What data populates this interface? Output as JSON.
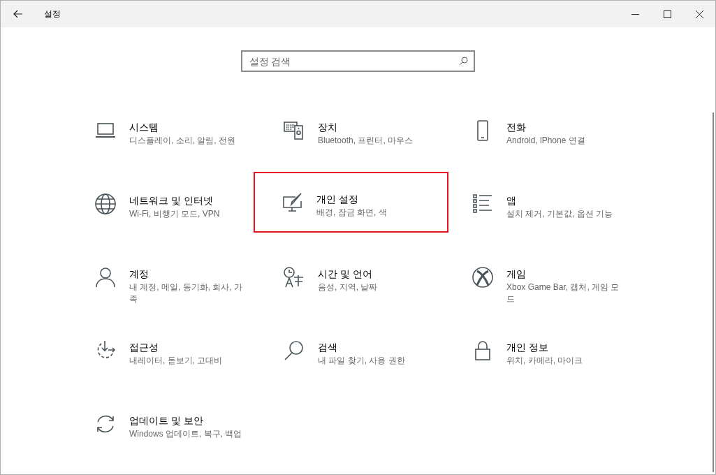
{
  "window": {
    "title": "설정"
  },
  "search": {
    "placeholder": "설정 검색"
  },
  "tiles": [
    {
      "title": "시스템",
      "subtitle": "디스플레이, 소리, 알림, 전원",
      "highlighted": false
    },
    {
      "title": "장치",
      "subtitle": "Bluetooth, 프린터, 마우스",
      "highlighted": false
    },
    {
      "title": "전화",
      "subtitle": "Android, iPhone 연결",
      "highlighted": false
    },
    {
      "title": "네트워크 및 인터넷",
      "subtitle": "Wi-Fi, 비행기 모드, VPN",
      "highlighted": false
    },
    {
      "title": "개인 설정",
      "subtitle": "배경, 잠금 화면, 색",
      "highlighted": true
    },
    {
      "title": "앱",
      "subtitle": "설치 제거, 기본값, 옵션 기능",
      "highlighted": false
    },
    {
      "title": "계정",
      "subtitle": "내 계정, 메일, 동기화, 회사, 가족",
      "highlighted": false
    },
    {
      "title": "시간 및 언어",
      "subtitle": "음성, 지역, 날짜",
      "highlighted": false
    },
    {
      "title": "게임",
      "subtitle": "Xbox Game Bar, 캡처, 게임 모드",
      "highlighted": false
    },
    {
      "title": "접근성",
      "subtitle": "내레이터, 돋보기, 고대비",
      "highlighted": false
    },
    {
      "title": "검색",
      "subtitle": "내 파일 찾기, 사용 권한",
      "highlighted": false
    },
    {
      "title": "개인 정보",
      "subtitle": "위치, 카메라, 마이크",
      "highlighted": false
    },
    {
      "title": "업데이트 및 보안",
      "subtitle": "Windows 업데이트, 복구, 백업",
      "highlighted": false
    }
  ]
}
